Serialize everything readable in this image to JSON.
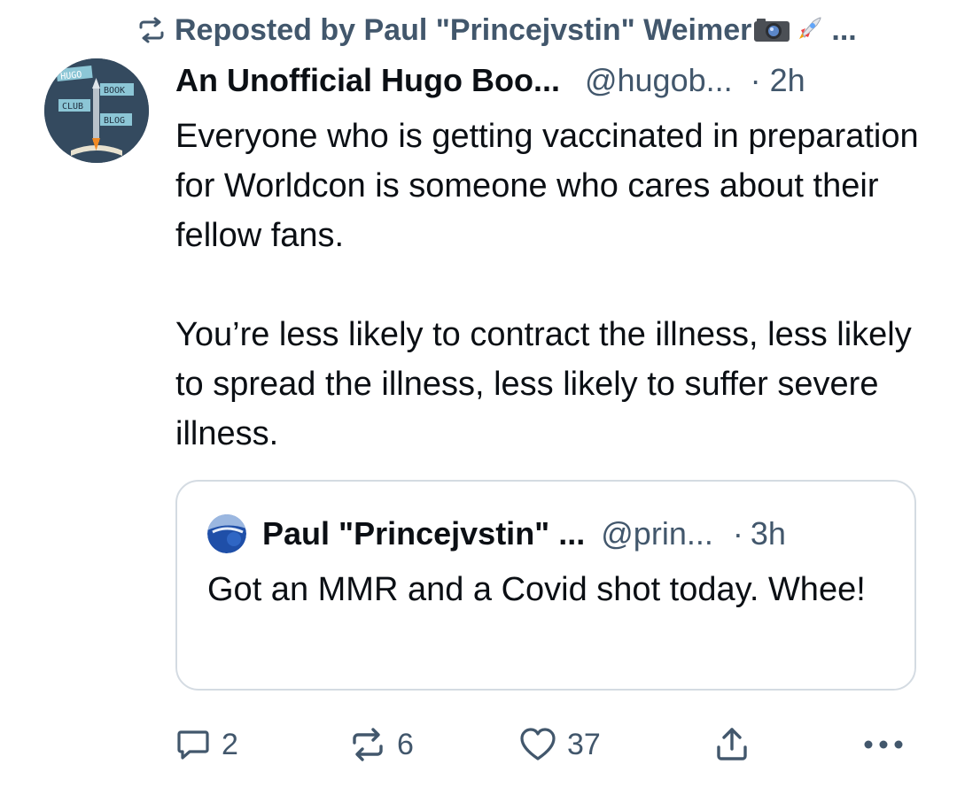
{
  "repost": {
    "label": "Reposted by Paul \"Princejvstin\" Weimer",
    "more": "..."
  },
  "post": {
    "author": "An Unofficial Hugo Boo...",
    "handle": "@hugob...",
    "separator": "·",
    "time": "2h",
    "avatar_text": {
      "line1": "HUGO",
      "line2": "BOOK",
      "line3": "CLUB",
      "line4": "BLOG"
    },
    "paragraph1": "Everyone who is getting vaccinated in preparation for Worldcon is someone who cares about their fellow fans.",
    "paragraph2": "You’re less likely to contract the illness, less likely to spread the illness, less likely to suffer severe illness."
  },
  "quote": {
    "author": "Paul \"Princejvstin\" ...",
    "handle": "@prin...",
    "separator": "·",
    "time": "3h",
    "text": "Got an MMR and a Covid shot today. Whee!"
  },
  "actions": {
    "replies": "2",
    "reposts": "6",
    "likes": "37"
  },
  "colors": {
    "text": "#0b0f14",
    "muted": "#42576c",
    "border": "#d4dbe2",
    "background": "#ffffff"
  },
  "icons": [
    "repost-icon",
    "camera-emoji",
    "rocket-emoji",
    "reply-icon",
    "repost-action-icon",
    "heart-icon",
    "share-icon",
    "more-icon"
  ]
}
